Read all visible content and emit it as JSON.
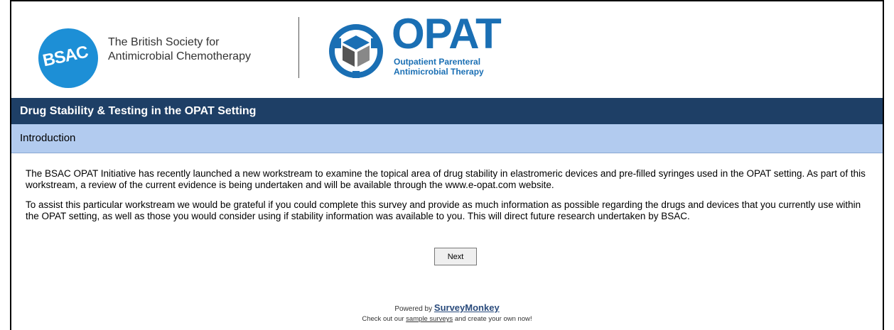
{
  "header": {
    "bsac_logo_text": "BSAC",
    "bsac_name_line1": "The British Society for",
    "bsac_name_line2": "Antimicrobial Chemotherapy",
    "opat_title": "OPAT",
    "opat_sub_line1": "Outpatient Parenteral",
    "opat_sub_line2": "Antimicrobial Therapy"
  },
  "survey": {
    "title": "Drug Stability & Testing in the OPAT Setting",
    "section": "Introduction",
    "paragraph1": "The BSAC OPAT Initiative has recently launched a new workstream to examine the topical area of drug stability in elastromeric devices and pre-filled syringes used in the OPAT setting. As part of this workstream, a review of the current evidence is being undertaken and will be available through the www.e-opat.com website.",
    "paragraph2": "To assist this particular workstream we would be grateful if you could complete this survey and provide as much information as possible regarding the drugs and devices that you currently use within the OPAT setting, as well as those you would consider using if stability information was available to you. This will direct future research undertaken by BSAC.",
    "next_label": "Next"
  },
  "footer": {
    "powered_by": "Powered by",
    "brand": "SurveyMonkey",
    "check_out_prefix": "Check out our",
    "sample_link": "sample surveys",
    "check_out_suffix": "and create your own now!"
  },
  "colors": {
    "title_bar": "#1e3f66",
    "section_bar": "#b2cbef",
    "bsac_blue": "#1d8fd6",
    "opat_blue": "#1a6fb4"
  }
}
